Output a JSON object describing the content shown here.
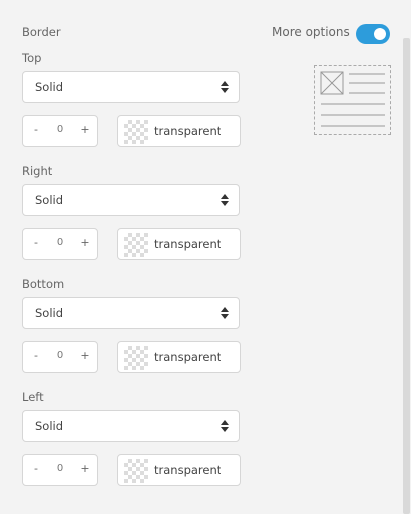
{
  "panel": {
    "section_title": "Border",
    "more_options_label": "More options",
    "more_options_enabled": true,
    "accent_color": "#2d9cdb"
  },
  "sides": [
    {
      "label": "Top",
      "style": "Solid",
      "width": "0",
      "color": "transparent"
    },
    {
      "label": "Right",
      "style": "Solid",
      "width": "0",
      "color": "transparent"
    },
    {
      "label": "Bottom",
      "style": "Solid",
      "width": "0",
      "color": "transparent"
    },
    {
      "label": "Left",
      "style": "Solid",
      "width": "0",
      "color": "transparent"
    }
  ],
  "stepper": {
    "minus": "-",
    "plus": "+"
  },
  "icons": {
    "caret": "up-down-caret-icon",
    "preview": "layout-preview-icon",
    "swatch": "transparent-swatch-icon"
  }
}
